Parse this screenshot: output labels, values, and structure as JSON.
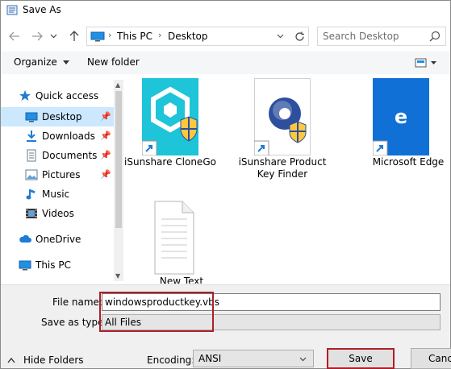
{
  "window": {
    "title": "Save As"
  },
  "nav": {
    "back_icon": "arrow-left-icon",
    "forward_icon": "arrow-right-icon",
    "recent_icon": "chevron-down-icon",
    "up_icon": "arrow-up-icon",
    "address": [
      "This PC",
      "Desktop"
    ],
    "search_placeholder": "Search Desktop"
  },
  "toolbar": {
    "organize_label": "Organize",
    "new_folder_label": "New folder"
  },
  "sidebar": {
    "items": [
      {
        "label": "Quick access",
        "icon": "star-icon"
      },
      {
        "label": "Desktop",
        "icon": "desktop-icon",
        "pinned": true,
        "selected": true
      },
      {
        "label": "Downloads",
        "icon": "download-icon",
        "pinned": true
      },
      {
        "label": "Documents",
        "icon": "documents-icon",
        "pinned": true
      },
      {
        "label": "Pictures",
        "icon": "pictures-icon",
        "pinned": true
      },
      {
        "label": "Music",
        "icon": "music-icon"
      },
      {
        "label": "Videos",
        "icon": "videos-icon"
      },
      {
        "label": "OneDrive",
        "icon": "cloud-icon"
      },
      {
        "label": "This PC",
        "icon": "computer-icon"
      }
    ]
  },
  "files": [
    {
      "label": "iSunshare CloneGo",
      "icon": "clonego-icon",
      "color": "#1ec4d8"
    },
    {
      "label": "iSunshare Product Key Finder",
      "icon": "product-key-finder-icon",
      "color": "#2d4f9e"
    },
    {
      "label": "Microsoft Edge",
      "icon": "edge-icon",
      "color": "#1070d6"
    },
    {
      "label": "New Text",
      "icon": "text-document-icon",
      "color": "#ffffff"
    }
  ],
  "save_form": {
    "file_name_label": "File name:",
    "file_name_value": "windowsproductkey.vbs",
    "save_as_type_label": "Save as type:",
    "save_as_type_value": "All Files",
    "encoding_label": "Encoding:",
    "encoding_value": "ANSI",
    "hide_folders_label": "Hide Folders",
    "save_label": "Save",
    "cancel_label": "Cance"
  },
  "colors": {
    "highlight": "#b01e28",
    "selection": "#cce8ff",
    "accent": "#0078d7"
  }
}
